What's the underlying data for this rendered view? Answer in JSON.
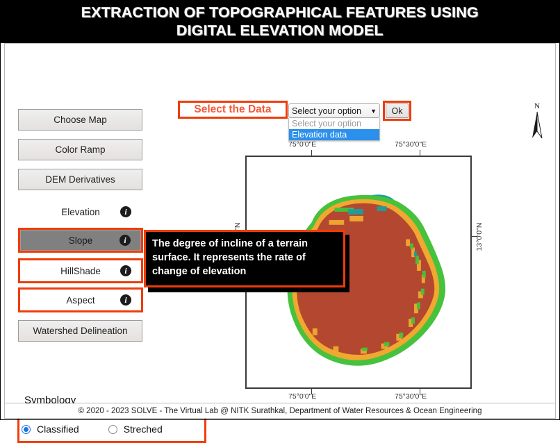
{
  "title": {
    "line1": "EXTRACTION OF TOPOGRAPHICAL FEATURES USING",
    "line2": "DIGITAL ELEVATION MODEL"
  },
  "sidebar": {
    "buttons": [
      {
        "label": "Choose Map"
      },
      {
        "label": "Color Ramp"
      },
      {
        "label": "DEM Derivatives"
      }
    ],
    "derivatives": [
      {
        "label": "Elevation",
        "info": "i",
        "highlighted": false,
        "active": false
      },
      {
        "label": "Slope",
        "info": "i",
        "highlighted": true,
        "active": true
      },
      {
        "label": "HillShade",
        "info": "i",
        "highlighted": true,
        "active": false
      },
      {
        "label": "Aspect",
        "info": "i",
        "highlighted": true,
        "active": false
      }
    ],
    "watershed_label": "Watershed Delineation"
  },
  "select_data": {
    "label": "Select the Data",
    "dropdown": {
      "value": "Select your option",
      "expanded": true,
      "options": [
        {
          "label": "Select your option",
          "state": "placeholder"
        },
        {
          "label": "Elevation data",
          "state": "highlighted"
        }
      ]
    },
    "ok_label": "Ok"
  },
  "tooltip": {
    "text": "The degree of incline of a terrain surface. It represents the rate of change of elevation"
  },
  "map": {
    "north_label": "N",
    "x_ticks_top": [
      "75°0'0\"E",
      "75°30'0\"E"
    ],
    "x_ticks_bottom": [
      "75°0'0\"E",
      "75°30'0\"E"
    ],
    "y_tick_left": "13°0'0\"N",
    "y_tick_right": "13°0'0\"N"
  },
  "symbology": {
    "title": "Symbology",
    "options": [
      {
        "label": "Classified",
        "selected": true
      },
      {
        "label": "Streched",
        "selected": false
      }
    ]
  },
  "footer": {
    "text": "© 2020 - 2023 SOLVE - The Virtual Lab @ NITK Surathkal, Department of Water Resources & Ocean Engineering"
  },
  "colors": {
    "accent_red": "#f03c0a",
    "label_red": "#f4593a",
    "select_blue": "#2b90ec",
    "radio_blue": "#1a73e8",
    "map_base": "#b4472f",
    "map_mid": "#f0a830",
    "map_high": "#46c23c",
    "map_peak": "#19a0a0"
  }
}
